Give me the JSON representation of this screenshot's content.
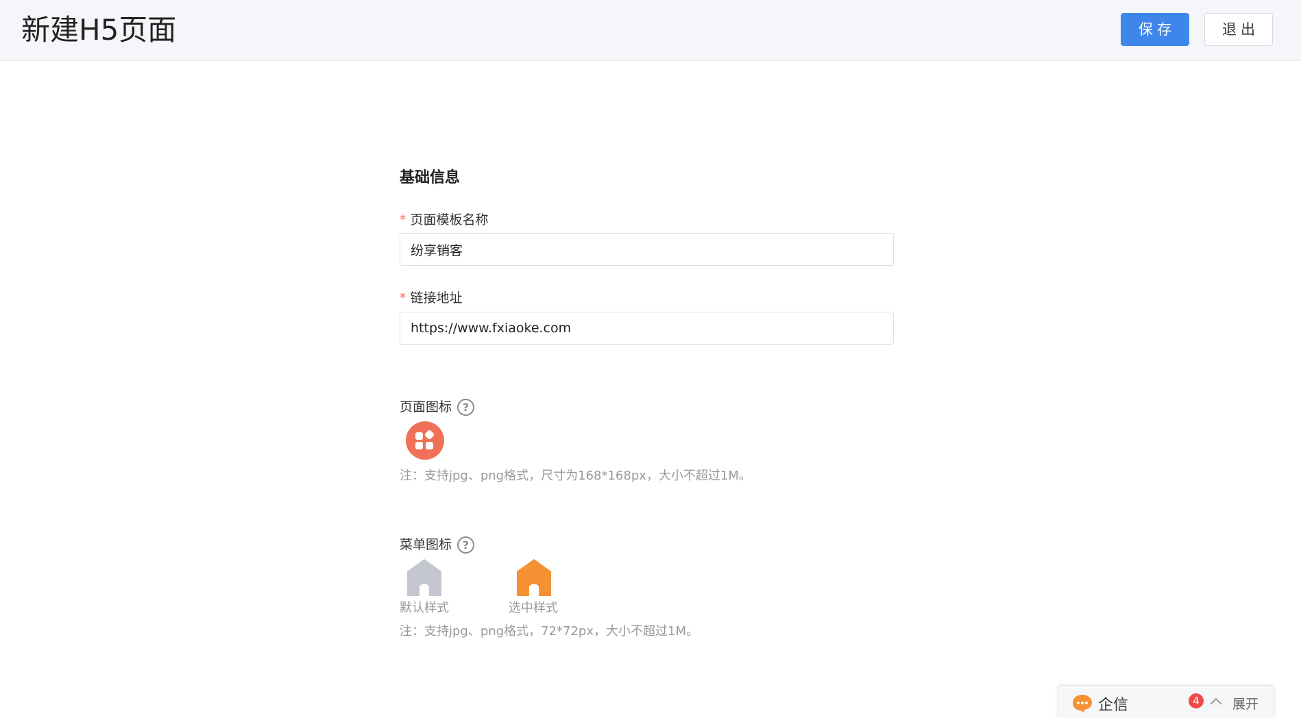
{
  "header": {
    "title": "新建H5页面",
    "save_label": "保存",
    "exit_label": "退出"
  },
  "form": {
    "section_title": "基础信息",
    "required_mark": "*",
    "template_name": {
      "label": "页面模板名称",
      "value": "纷享销客"
    },
    "link_url": {
      "label": "链接地址",
      "value": "https://www.fxiaoke.com"
    },
    "page_icon": {
      "label": "页面图标",
      "help": "?",
      "note": "注：支持jpg、png格式，尺寸为168*168px，大小不超过1M。",
      "icon": "grid-icon",
      "color": "#ef7258"
    },
    "menu_icon": {
      "label": "菜单图标",
      "help": "?",
      "default_caption": "默认样式",
      "selected_caption": "选中样式",
      "note": "注：支持jpg、png格式，72*72px，大小不超过1M。",
      "default_color": "#c4c6d0",
      "selected_color": "#f39133"
    }
  },
  "chat": {
    "title": "企信",
    "badge": "4",
    "expand_label": "展开"
  },
  "colors": {
    "primary": "#3f86ea",
    "required": "#f56c6c"
  }
}
